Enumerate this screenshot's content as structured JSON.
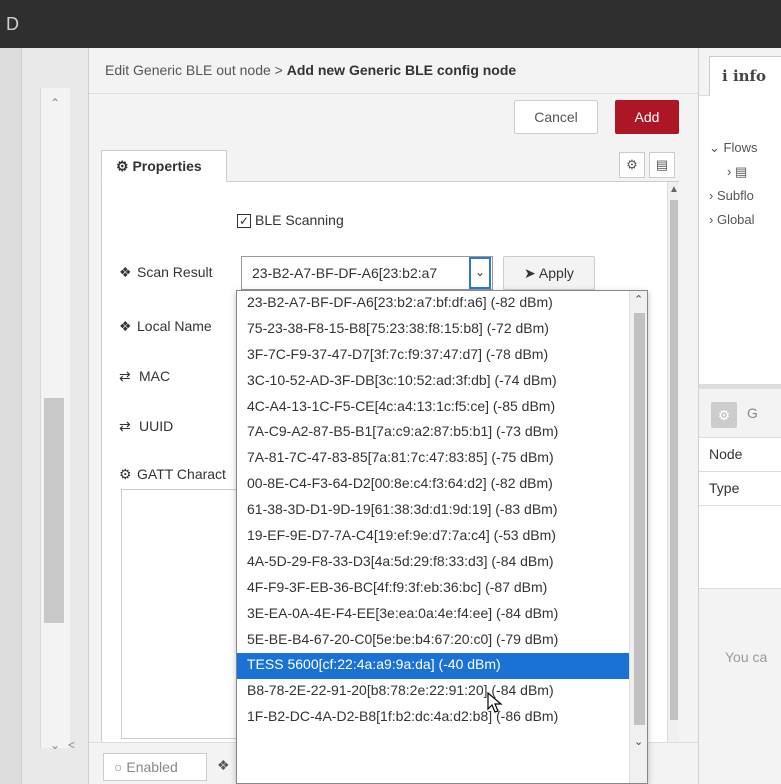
{
  "topbar": {
    "corner_char": "D"
  },
  "tray": {
    "breadcrumb_prefix": "Edit Generic BLE out node > ",
    "breadcrumb_title": "Add new Generic BLE config node",
    "cancel_label": "Cancel",
    "add_label": "Add",
    "tab_properties": "Properties"
  },
  "form": {
    "ble_scanning_label": "BLE Scanning",
    "ble_scanning_checked": true,
    "scan_result_label": "Scan Result",
    "scan_result_value": "23-B2-A7-BF-DF-A6[23:b2:a7",
    "apply_label": "Apply",
    "local_name_label": "Local Name",
    "mac_label": "MAC",
    "uuid_label": "UUID",
    "gatt_label": "GATT Charact"
  },
  "dropdown": {
    "selected_index": 15,
    "options": [
      "23-B2-A7-BF-DF-A6[23:b2:a7:bf:df:a6] (-82 dBm)",
      "75-23-38-F8-15-B8[75:23:38:f8:15:b8] (-72 dBm)",
      "3F-7C-F9-37-47-D7[3f:7c:f9:37:47:d7] (-78 dBm)",
      "3C-10-52-AD-3F-DB[3c:10:52:ad:3f:db] (-74 dBm)",
      "4C-A4-13-1C-F5-CE[4c:a4:13:1c:f5:ce] (-85 dBm)",
      "7A-C9-A2-87-B5-B1[7a:c9:a2:87:b5:b1] (-73 dBm)",
      "7A-81-7C-47-83-85[7a:81:7c:47:83:85] (-75 dBm)",
      "00-8E-C4-F3-64-D2[00:8e:c4:f3:64:d2] (-82 dBm)",
      "61-38-3D-D1-9D-19[61:38:3d:d1:9d:19] (-83 dBm)",
      "19-EF-9E-D7-7A-C4[19:ef:9e:d7:7a:c4] (-53 dBm)",
      "4A-5D-29-F8-33-D3[4a:5d:29:f8:33:d3] (-84 dBm)",
      "4F-F9-3F-EB-36-BC[4f:f9:3f:eb:36:bc] (-87 dBm)",
      "3E-EA-0A-4E-F4-EE[3e:ea:0a:4e:f4:ee] (-84 dBm)",
      "5E-BE-B4-67-20-C0[5e:be:b4:67:20:c0] (-79 dBm)",
      "TESS 5600[cf:22:4a:a9:9a:da] (-40 dBm)",
      "B8-78-2E-22-91-20[b8:78:2e:22:91:20] (-84 dBm)",
      "1F-B2-DC-4A-D2-B8[1f:b2:dc:4a:d2:b8] (-86 dBm)"
    ]
  },
  "bottom": {
    "enabled_label": "Enabled"
  },
  "sidebar": {
    "info_icon_char": "i",
    "tab_info": "info",
    "tree": [
      "Flows",
      "",
      "Subflo",
      "Global"
    ],
    "section_g": "G",
    "row_node": "Node",
    "row_type": "Type",
    "empty_text": "You ca"
  },
  "colors": {
    "accent_red": "#ad1625",
    "selection_blue": "#1a73d4",
    "focus_blue": "#2a7ad5"
  }
}
